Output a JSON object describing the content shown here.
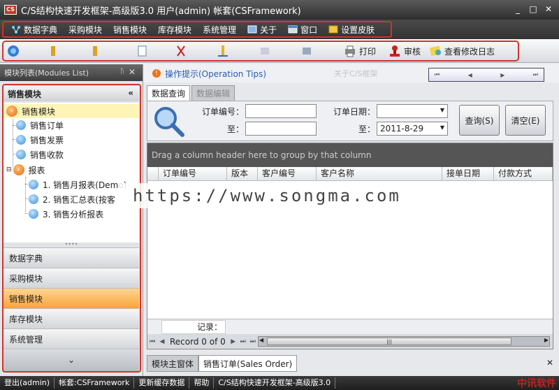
{
  "window": {
    "title": "C/S结构快速开发框架-高级版3.0 用户(admin) 帐套(CSFramework)",
    "logo_text": "CS",
    "min": "_",
    "max": "□",
    "close": "✕"
  },
  "menu": {
    "items": [
      "数据字典",
      "采购模块",
      "销售模块",
      "库存模块",
      "系统管理",
      "关于",
      "窗口",
      "设置皮肤"
    ]
  },
  "toolbar": {
    "print": "打印",
    "audit": "审核",
    "view_log": "查看修改日志"
  },
  "left_panel": {
    "title": "模块列表(Modules List)",
    "pin": "ᚢ",
    "close": "✕",
    "group_title": "销售模块",
    "group_chev": "«",
    "tree": {
      "root": "销售模块",
      "items": [
        "销售订单",
        "销售发票",
        "销售收款"
      ],
      "report_group": "报表",
      "reports": [
        "1. 销售月报表(Demo)",
        "2. 销售汇总表(按客",
        "3. 销售分析报表"
      ]
    },
    "splitter": "••••",
    "nav": [
      "数据字典",
      "采购模块",
      "销售模块",
      "库存模块",
      "系统管理"
    ],
    "nav_active_index": 2,
    "nav_bottom": "⌄"
  },
  "main": {
    "tips_icon": "!",
    "tips": "操作提示(Operation Tips)",
    "about_link": "关于C/S框架",
    "nav_mini": [
      "⏮",
      "◀",
      "▶",
      "⏭"
    ],
    "tabs": [
      "数据查询",
      "数据编辑"
    ],
    "search": {
      "order_no_label": "订单编号：",
      "to_label_1": "至：",
      "order_date_label": "订单日期：",
      "to_label_2": "至：",
      "order_no_from": "",
      "order_no_to": "",
      "date_from": "",
      "date_to": "2011-8-29",
      "query_button": "查询(S)",
      "clear_button": "清空(E)"
    },
    "grid": {
      "group_hint": "Drag a column header here to group by that column",
      "columns": [
        "订单编号",
        "版本",
        "客户编号",
        "客户名称",
        "接单日期",
        "付款方式"
      ],
      "record_label": "记录：",
      "pager_text": "Record 0 of 0",
      "pager_first": "⏮",
      "pager_prev": "◀",
      "pager_next": "▶",
      "pager_next_page": "⏭",
      "pager_last": "⏭",
      "scroll_left": "◀",
      "scroll_right": "▶",
      "scroll_thumb": "|||"
    },
    "doc_tabs": [
      "模块主窗体",
      "销售订单(Sales Order)"
    ],
    "doc_close": "✕"
  },
  "status": {
    "segments": [
      "登出(admin)",
      "帐套:CSFramework",
      "更新缓存数据",
      "帮助",
      "C/S结构快速开发框架-高级版3.0"
    ]
  },
  "overlay": {
    "watermark": "https://www.songma.com",
    "brand": "中讯软件"
  },
  "colors": {
    "highlight_red": "#d0342c",
    "active_nav": "#f7a43a",
    "tips_blue": "#2a5db0"
  }
}
